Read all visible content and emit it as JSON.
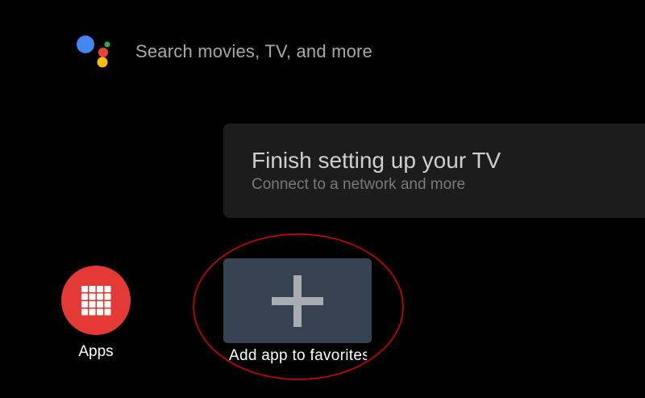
{
  "search": {
    "placeholder": "Search movies, TV, and more",
    "assistant_icon": "google-assistant-icon"
  },
  "setup_card": {
    "title": "Finish setting up your TV",
    "subtitle": "Connect to a network and more"
  },
  "apps_launcher": {
    "label": "Apps",
    "icon": "grid-icon",
    "color": "#e53935"
  },
  "favorites": {
    "add_label": "Add app to favorites",
    "icon": "plus-icon",
    "tile_color": "#374352"
  },
  "annotation": {
    "highlight_color": "#e00000"
  },
  "colors": {
    "background": "#000000",
    "assistant_blue": "#4285f4",
    "assistant_red": "#ea4335",
    "assistant_yellow": "#fbbc05",
    "assistant_green": "#34a853"
  }
}
